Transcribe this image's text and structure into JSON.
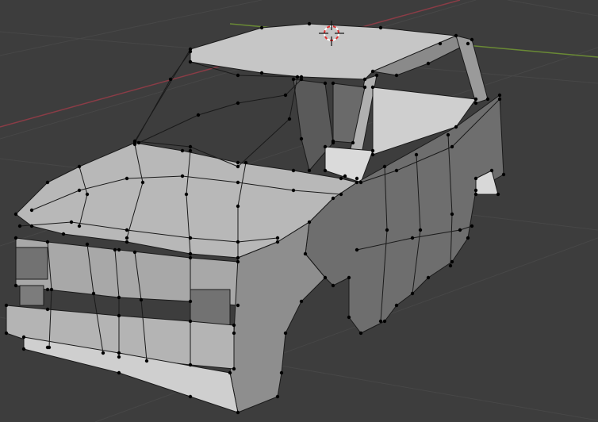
{
  "viewport": {
    "mode": "edit-mode-wireframe",
    "object": "car-body-mesh"
  },
  "colors": {
    "background": "#3d3d3d",
    "grid_line": "#474747",
    "x_axis": "#8a3c46",
    "y_axis": "#6a8a35",
    "mesh_light": "#c9c9c9",
    "mesh_mid": "#9c9c9c",
    "mesh_dark": "#6a6a6a",
    "edge": "#1a1a1a",
    "vertex": "#000000",
    "cursor_red": "#e03030",
    "cursor_white": "#ffffff"
  },
  "icons": {
    "cursor": "3d-cursor-icon"
  }
}
